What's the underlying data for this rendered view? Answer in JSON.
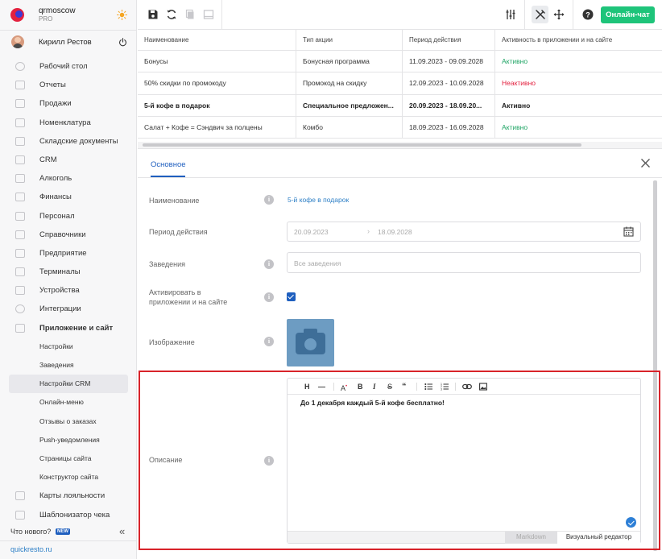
{
  "brand": {
    "name": "qrmoscow",
    "plan": "PRO"
  },
  "user": {
    "name": "Кирилл Рестов"
  },
  "sidebar": {
    "items": [
      {
        "label": "Рабочий стол",
        "icon": "dashboard-icon"
      },
      {
        "label": "Отчеты",
        "icon": "reports-icon"
      },
      {
        "label": "Продажи",
        "icon": "sales-icon"
      },
      {
        "label": "Номенклатура",
        "icon": "nomenclature-icon"
      },
      {
        "label": "Складские документы",
        "icon": "warehouse-icon"
      },
      {
        "label": "CRM",
        "icon": "crm-icon"
      },
      {
        "label": "Алкоголь",
        "icon": "alcohol-icon"
      },
      {
        "label": "Финансы",
        "icon": "finance-icon"
      },
      {
        "label": "Персонал",
        "icon": "staff-icon"
      },
      {
        "label": "Справочники",
        "icon": "directories-icon"
      },
      {
        "label": "Предприятие",
        "icon": "enterprise-icon"
      },
      {
        "label": "Терминалы",
        "icon": "terminals-icon"
      },
      {
        "label": "Устройства",
        "icon": "devices-icon"
      },
      {
        "label": "Интеграции",
        "icon": "integrations-icon"
      },
      {
        "label": "Приложение и сайт",
        "icon": "app-site-icon"
      }
    ],
    "subitems": [
      {
        "label": "Настройки"
      },
      {
        "label": "Заведения"
      },
      {
        "label": "Настройки CRM",
        "active": true
      },
      {
        "label": "Онлайн-меню"
      },
      {
        "label": "Отзывы о заказах"
      },
      {
        "label": "Push-уведомления"
      },
      {
        "label": "Страницы сайта"
      },
      {
        "label": "Конструктор сайта"
      }
    ],
    "tail_items": [
      {
        "label": "Карты лояльности",
        "icon": "loyalty-cards-icon"
      },
      {
        "label": "Шаблонизатор чека",
        "icon": "receipt-template-icon"
      }
    ],
    "whats_new": "Что нового?",
    "new_badge": "NEW",
    "site_link": "quickresto.ru"
  },
  "toolbar": {
    "online_chat": "Онлайн-чат"
  },
  "table": {
    "columns": [
      "Наименование",
      "Тип акции",
      "Период действия",
      "Активность в приложении и на сайте"
    ],
    "rows": [
      {
        "name": "Бонусы",
        "type": "Бонусная программа",
        "period": "11.09.2023 - 09.09.2028",
        "status": "Активно",
        "status_kind": "ok",
        "bold": false
      },
      {
        "name": "50% скидки по промокоду",
        "type": "Промокод на скидку",
        "period": "12.09.2023 - 10.09.2028",
        "status": "Неактивно",
        "status_kind": "bad",
        "bold": false
      },
      {
        "name": "5-й кофе в подарок",
        "type": "Специальное предложен...",
        "period": "20.09.2023 - 18.09.20...",
        "status": "Активно",
        "status_kind": "ok",
        "bold": true
      },
      {
        "name": "Салат + Кофе = Сэндвич за полцены",
        "type": "Комбо",
        "period": "18.09.2023 - 16.09.2028",
        "status": "Активно",
        "status_kind": "ok",
        "bold": false
      }
    ]
  },
  "form": {
    "tab": "Основное",
    "fields": {
      "name_label": "Наименование",
      "name_value": "5-й кофе в подарок",
      "period_label": "Период действия",
      "period_from": "20.09.2023",
      "period_to": "18.09.2028",
      "venues_label": "Заведения",
      "venues_placeholder": "Все заведения",
      "activate_label_1": "Активировать в",
      "activate_label_2": "приложении и на сайте",
      "activate_checked": true,
      "image_label": "Изображение",
      "description_label": "Описание"
    },
    "editor": {
      "text": "До 1 декабря каждый 5-й кофе бесплатно!",
      "tab_markdown": "Markdown",
      "tab_visual": "Визуальный редактор"
    }
  },
  "colors": {
    "accent": "#1f5fbf",
    "online_btn": "#1ec47a",
    "active": "#1ea464",
    "inactive": "#e3213f",
    "highlight": "#d8232a"
  }
}
